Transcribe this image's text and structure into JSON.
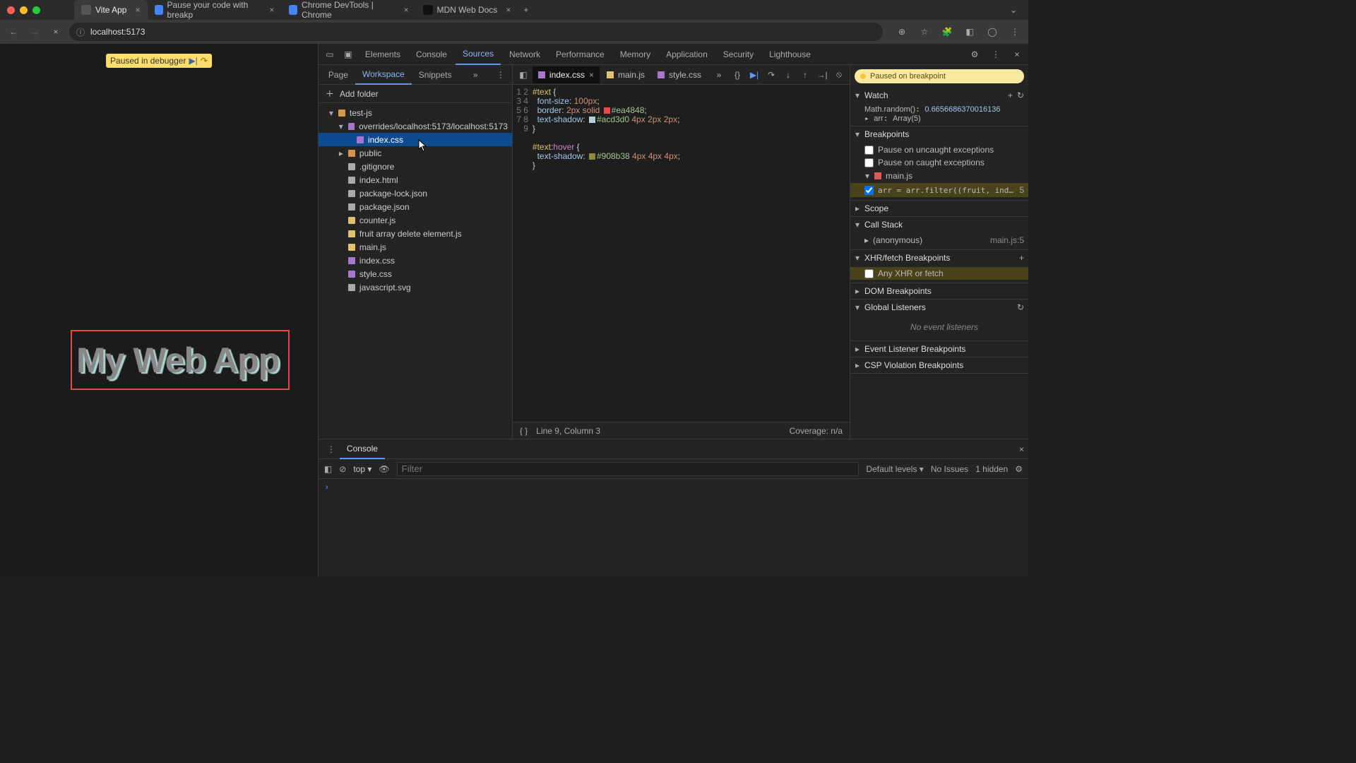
{
  "titlebar": {
    "tabs": [
      {
        "label": "Vite App",
        "active": true
      },
      {
        "label": "Pause your code with breakp"
      },
      {
        "label": "Chrome DevTools | Chrome"
      },
      {
        "label": "MDN Web Docs"
      }
    ]
  },
  "urlbar": {
    "text": "localhost:5173"
  },
  "page": {
    "paused_label": "Paused in debugger",
    "heading": "My Web App"
  },
  "devtools": {
    "tabs": [
      "Elements",
      "Console",
      "Sources",
      "Network",
      "Performance",
      "Memory",
      "Application",
      "Security",
      "Lighthouse"
    ],
    "active": "Sources",
    "subtabs": [
      "Page",
      "Workspace",
      "Snippets"
    ],
    "active_subtab": "Workspace",
    "addfolder_label": "Add folder",
    "tree": {
      "root": "test-js",
      "override_path": "overrides/localhost:5173/localhost:5173",
      "selected": "index.css",
      "public_folder": "public",
      "files": [
        ".gitignore",
        "index.html",
        "package-lock.json",
        "package.json",
        "counter.js",
        "fruit array delete element.js",
        "main.js",
        "index.css",
        "style.css",
        "javascript.svg"
      ]
    },
    "opentabs": [
      {
        "label": "index.css",
        "active": true,
        "type": "css"
      },
      {
        "label": "main.js",
        "type": "js"
      },
      {
        "label": "style.css",
        "type": "css"
      }
    ],
    "code": {
      "lines": [
        "#text {",
        "  font-size: 100px;",
        "  border: 2px solid ■#ea4848;",
        "  text-shadow: ■#acd3d0 4px 2px 2px;",
        "}",
        "",
        "#text:hover {",
        "  text-shadow: ■#908b38 4px 4px 4px;",
        "}"
      ],
      "status": "Line 9, Column 3",
      "coverage": "Coverage: n/a"
    },
    "paused_banner": "Paused on breakpoint",
    "watch": {
      "title": "Watch",
      "lines": [
        {
          "expr": "Math.random()",
          "val": "0.6656686370016136"
        },
        {
          "expr": "arr",
          "val": "Array(5)"
        }
      ]
    },
    "breakpoints": {
      "title": "Breakpoints",
      "uncaught": "Pause on uncaught exceptions",
      "caught": "Pause on caught exceptions",
      "file": "main.js",
      "codeline": "arr = arr.filter((fruit, ind…",
      "lineno": "5"
    },
    "sections": {
      "scope": "Scope",
      "callstack": "Call Stack",
      "anon": "(anonymous)",
      "anon_loc": "main.js:5",
      "xhr": "XHR/fetch Breakpoints",
      "anyxhr": "Any XHR or fetch",
      "dom": "DOM Breakpoints",
      "global": "Global Listeners",
      "nolisten": "No event listeners",
      "evlisten": "Event Listener Breakpoints",
      "csp": "CSP Violation Breakpoints"
    }
  },
  "drawer": {
    "tab": "Console",
    "top": "top",
    "filter_placeholder": "Filter",
    "levels": "Default levels",
    "noissues": "No Issues",
    "hidden": "1 hidden"
  }
}
